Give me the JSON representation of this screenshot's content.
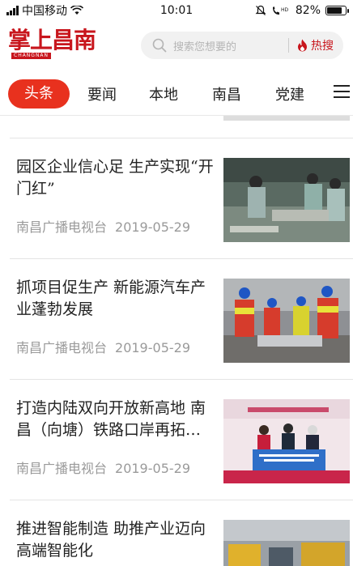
{
  "status_bar": {
    "carrier": "中国移动",
    "time": "10:01",
    "network": "4G",
    "battery": "82%",
    "battery_level": 0.82
  },
  "header": {
    "logo_text": "掌上昌南",
    "logo_sub": "CHANGNAN",
    "search_placeholder": "搜索您想要的",
    "hot_search_label": "热搜",
    "accent_color": "#c8161d"
  },
  "tabs": [
    {
      "label": "头条",
      "active": true
    },
    {
      "label": "要闻",
      "active": false
    },
    {
      "label": "本地",
      "active": false
    },
    {
      "label": "南昌",
      "active": false
    },
    {
      "label": "党建",
      "active": false
    }
  ],
  "news": [
    {
      "title": "园区企业信心足 生产实现“开门红”",
      "source": "南昌广播电视台",
      "date": "2019-05-29",
      "thumb": "factory-workers"
    },
    {
      "title": "抓项目促生产  新能源汽车产业蓬勃发展",
      "source": "南昌广播电视台",
      "date": "2019-05-29",
      "thumb": "workers-hardhats"
    },
    {
      "title": "打造内陆双向开放新高地 南昌（向塘）铁路口岸再拓…",
      "source": "南昌广播电视台",
      "date": "2019-05-29",
      "thumb": "ceremony-stage"
    },
    {
      "title": "推进智能制造 助推产业迈向高端智能化",
      "source": "",
      "date": "",
      "thumb": "machinery"
    }
  ]
}
